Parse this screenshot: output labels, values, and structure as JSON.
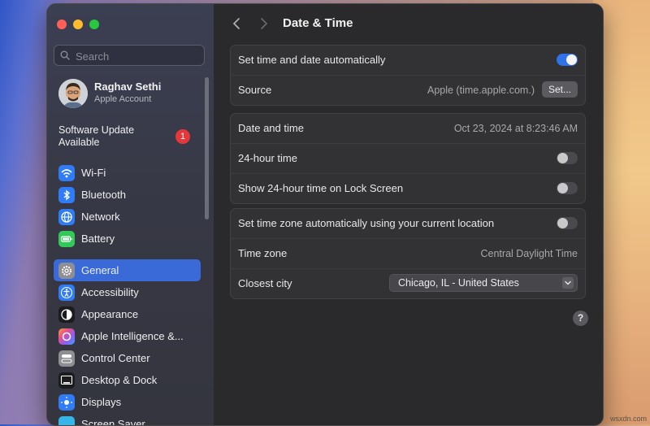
{
  "window": {
    "title": "Date & Time"
  },
  "colors": {
    "accent": "#3a6ad8",
    "toggle_on": "#2f72ea",
    "badge": "#e5383b"
  },
  "sidebar": {
    "search_placeholder": "Search",
    "account": {
      "name": "Raghav Sethi",
      "subtitle": "Apple Account"
    },
    "update": {
      "label": "Software Update Available",
      "badge": "1"
    },
    "items": [
      {
        "label": "Wi-Fi",
        "icon": "wifi-icon"
      },
      {
        "label": "Bluetooth",
        "icon": "bluetooth-icon"
      },
      {
        "label": "Network",
        "icon": "globe-icon"
      },
      {
        "label": "Battery",
        "icon": "battery-icon"
      },
      {
        "label": "General",
        "icon": "gear-icon",
        "active": true
      },
      {
        "label": "Accessibility",
        "icon": "accessibility-icon"
      },
      {
        "label": "Appearance",
        "icon": "appearance-icon"
      },
      {
        "label": "Apple Intelligence &...",
        "icon": "apple-intelligence-icon"
      },
      {
        "label": "Control Center",
        "icon": "control-center-icon"
      },
      {
        "label": "Desktop & Dock",
        "icon": "desktop-dock-icon"
      },
      {
        "label": "Displays",
        "icon": "displays-icon"
      },
      {
        "label": "Screen Saver",
        "icon": "screen-saver-icon"
      }
    ]
  },
  "main": {
    "title": "Date & Time",
    "groups": [
      {
        "rows": [
          {
            "label": "Set time and date automatically",
            "toggle": true
          },
          {
            "label": "Source",
            "value": "Apple (time.apple.com.)",
            "button": "Set..."
          }
        ]
      },
      {
        "rows": [
          {
            "label": "Date and time",
            "value": "Oct 23, 2024 at 8:23:46 AM"
          },
          {
            "label": "24-hour time",
            "toggle": false
          },
          {
            "label": "Show 24-hour time on Lock Screen",
            "toggle": false
          }
        ]
      },
      {
        "rows": [
          {
            "label": "Set time zone automatically using your current location",
            "toggle": false
          },
          {
            "label": "Time zone",
            "value": "Central Daylight Time"
          },
          {
            "label": "Closest city",
            "select": "Chicago, IL - United States"
          }
        ]
      }
    ],
    "help_label": "?"
  },
  "watermark": "wsxdn.com"
}
